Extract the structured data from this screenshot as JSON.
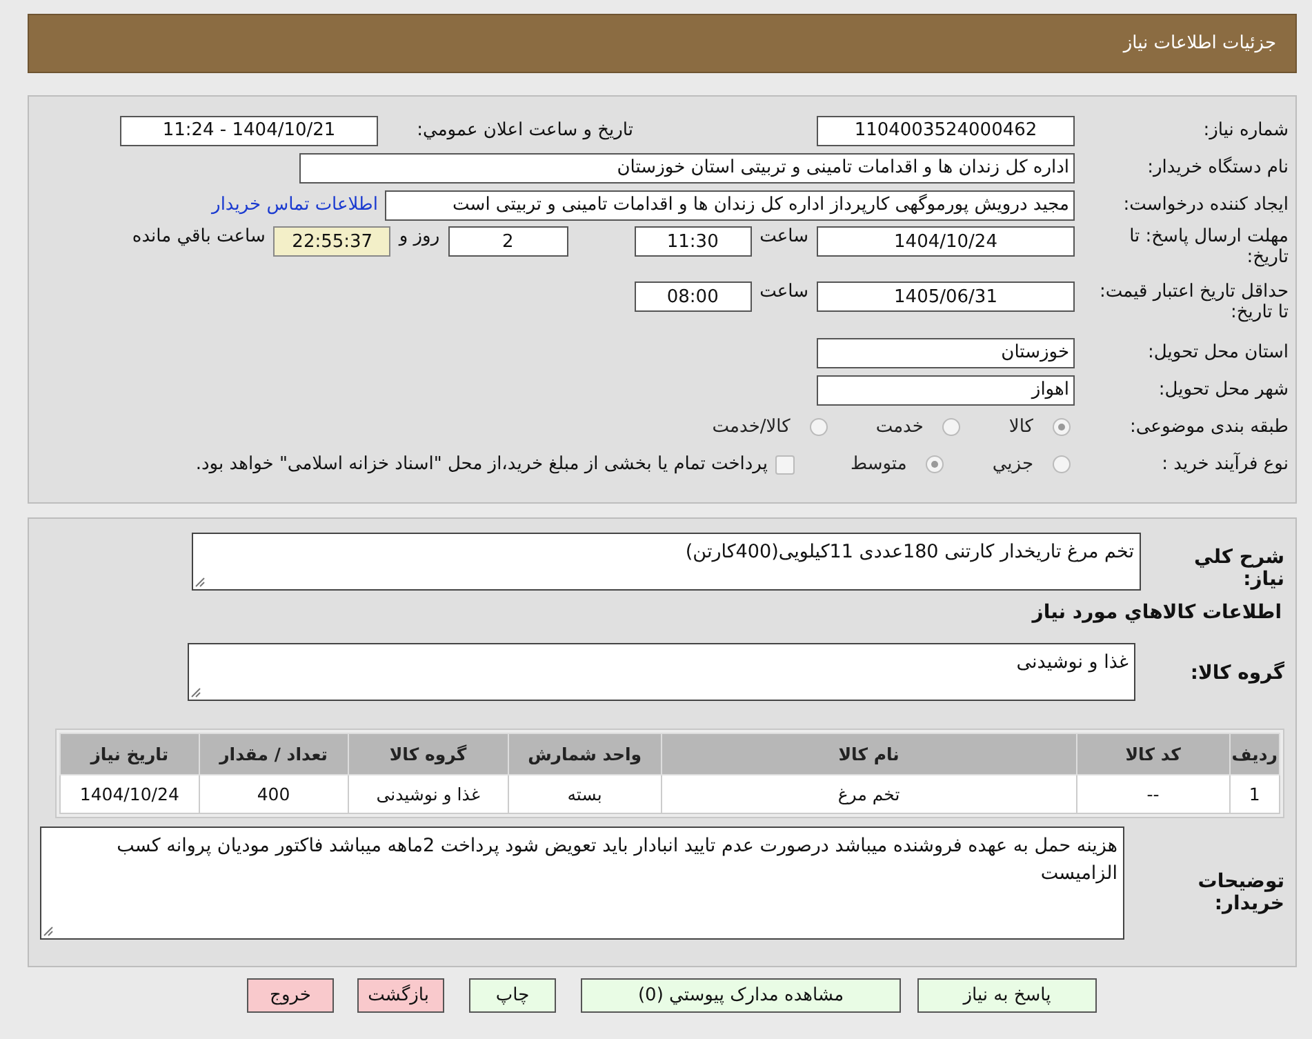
{
  "header": {
    "title": "جزئيات اطلاعات نياز"
  },
  "need_number": {
    "label": "شماره نیاز:",
    "value": "1104003524000462"
  },
  "announce": {
    "label": "تاریخ و ساعت اعلان عمومي:",
    "value": "1404/10/21 - 11:24"
  },
  "buyer_org": {
    "label": "نام دستگاه خریدار:",
    "value": "اداره کل زندان ها و اقدامات تامینی و تربیتی استان خوزستان"
  },
  "requester": {
    "label": "ایجاد کننده درخواست:",
    "value": "مجید درویش پورموگهی کارپرداز اداره کل زندان ها و اقدامات تامینی و تربیتی است",
    "link": "اطلاعات تماس خریدار"
  },
  "deadline": {
    "label": "مهلت ارسال پاسخ: تا تاریخ:",
    "date": "1404/10/24",
    "time_label": "ساعت",
    "time": "11:30",
    "days": "2",
    "days_label": "روز و",
    "remaining": "22:55:37",
    "remaining_label": "ساعت باقي مانده"
  },
  "validity": {
    "label": "حداقل تاریخ اعتبار قیمت: تا تاریخ:",
    "date": "1405/06/31",
    "time_label": "ساعت",
    "time": "08:00"
  },
  "province": {
    "label": "استان محل تحویل:",
    "value": "خوزستان"
  },
  "city": {
    "label": "شهر محل تحویل:",
    "value": "اهواز"
  },
  "category": {
    "label": "طبقه بندی موضوعی:",
    "options": [
      {
        "label": "کالا",
        "selected": true
      },
      {
        "label": "خدمت",
        "selected": false
      },
      {
        "label": "کالا/خدمت",
        "selected": false
      }
    ]
  },
  "process": {
    "label": "نوع فرآیند خرید :",
    "options": [
      {
        "label": "جزيي",
        "selected": false
      },
      {
        "label": "متوسط",
        "selected": true
      }
    ],
    "payment": {
      "checked": false,
      "label": "پرداخت تمام یا بخشی از مبلغ خرید،از محل \"اسناد خزانه اسلامی\" خواهد بود."
    }
  },
  "summary": {
    "label": "شرح کلي نياز:",
    "value": "تخم مرغ تاریخدار کارتنی 180عددی 11کیلویی(400کارتن)"
  },
  "items_title": "اطلاعات کالاهاي مورد نياز",
  "goods_group": {
    "label": "گروه کالا:",
    "value": "غذا و نوشیدنی"
  },
  "table": {
    "columns": [
      "رديف",
      "کد کالا",
      "نام کالا",
      "واحد شمارش",
      "گروه کالا",
      "تعداد / مقدار",
      "تاریخ نیاز"
    ],
    "rows": [
      [
        "1",
        "--",
        "تخم مرغ",
        "بسته",
        "غذا و نوشیدنی",
        "400",
        "1404/10/24"
      ]
    ]
  },
  "notes": {
    "label": "توضیحات خریدار:",
    "value": "هزینه حمل به عهده فروشنده میباشد درصورت عدم تایید انبادار باید تعویض شود پرداخت 2ماهه میباشد فاکتور مودیان  پروانه کسب الزامیست"
  },
  "buttons": [
    {
      "label": "پاسخ به نیاز",
      "kind": "normal"
    },
    {
      "label": "مشاهده مدارک پیوستي (0)",
      "kind": "normal"
    },
    {
      "label": "چاپ",
      "kind": "normal"
    },
    {
      "label": "بازگشت",
      "kind": "danger"
    },
    {
      "label": "خروج",
      "kind": "danger"
    }
  ]
}
